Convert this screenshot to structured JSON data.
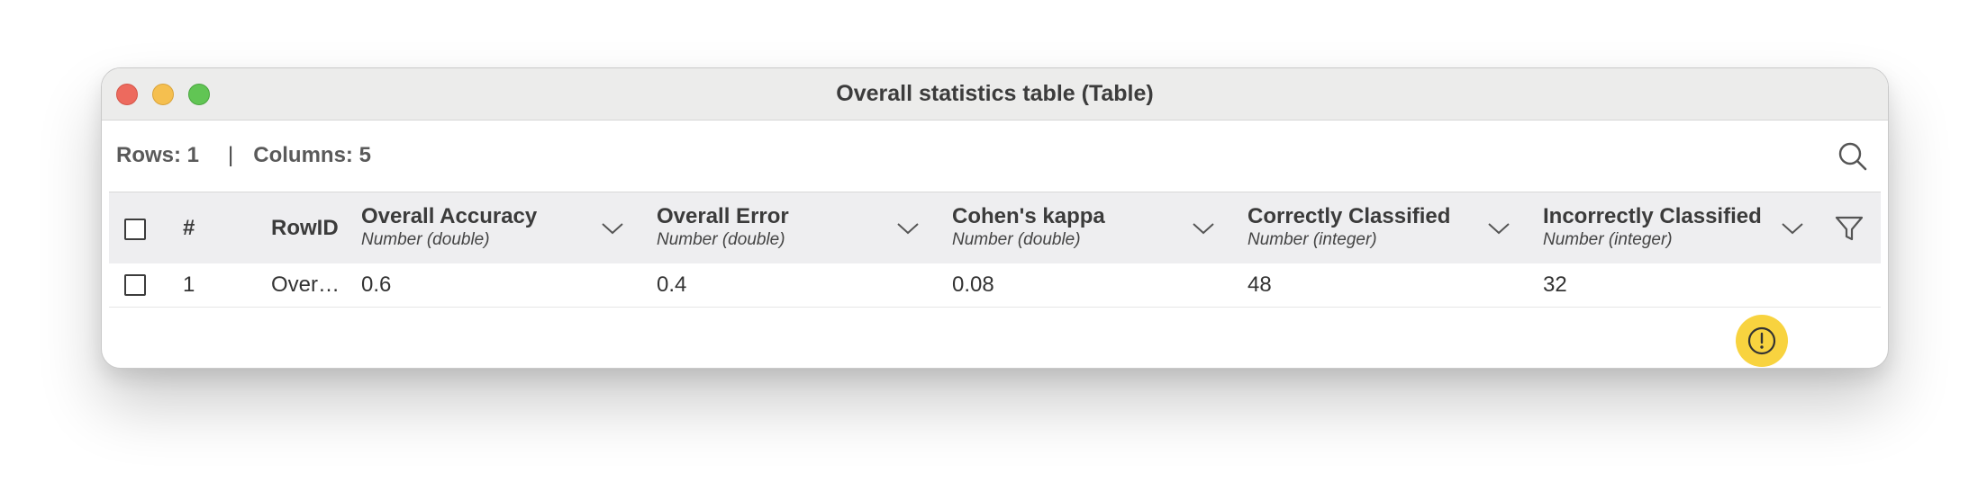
{
  "window": {
    "title": "Overall statistics table (Table)"
  },
  "info": {
    "rows_label": "Rows: 1",
    "separator": "|",
    "columns_label": "Columns: 5"
  },
  "table": {
    "fixed_headers": {
      "index": "#",
      "rowid": "RowID"
    },
    "columns": [
      {
        "name": "Overall Accuracy",
        "type": "Number (double)"
      },
      {
        "name": "Overall Error",
        "type": "Number (double)"
      },
      {
        "name": "Cohen's kappa",
        "type": "Number (double)"
      },
      {
        "name": "Correctly Classified",
        "type": "Number (integer)"
      },
      {
        "name": "Incorrectly Classified",
        "type": "Number (integer)"
      }
    ],
    "rows": [
      {
        "index": "1",
        "rowid": "Over…",
        "values": [
          "0.6",
          "0.4",
          "0.08",
          "48",
          "32"
        ]
      }
    ]
  },
  "icons": {
    "search": "search-icon",
    "filter": "filter-icon",
    "sort": "chevron-down-icon",
    "warning": "warning-icon"
  },
  "colors": {
    "titlebar": "#ececeb",
    "header_bg": "#eeeef0",
    "warning_badge": "#f8d33f",
    "close": "#ed6a5e",
    "minimize": "#f5bf4f",
    "zoom": "#61c554"
  }
}
